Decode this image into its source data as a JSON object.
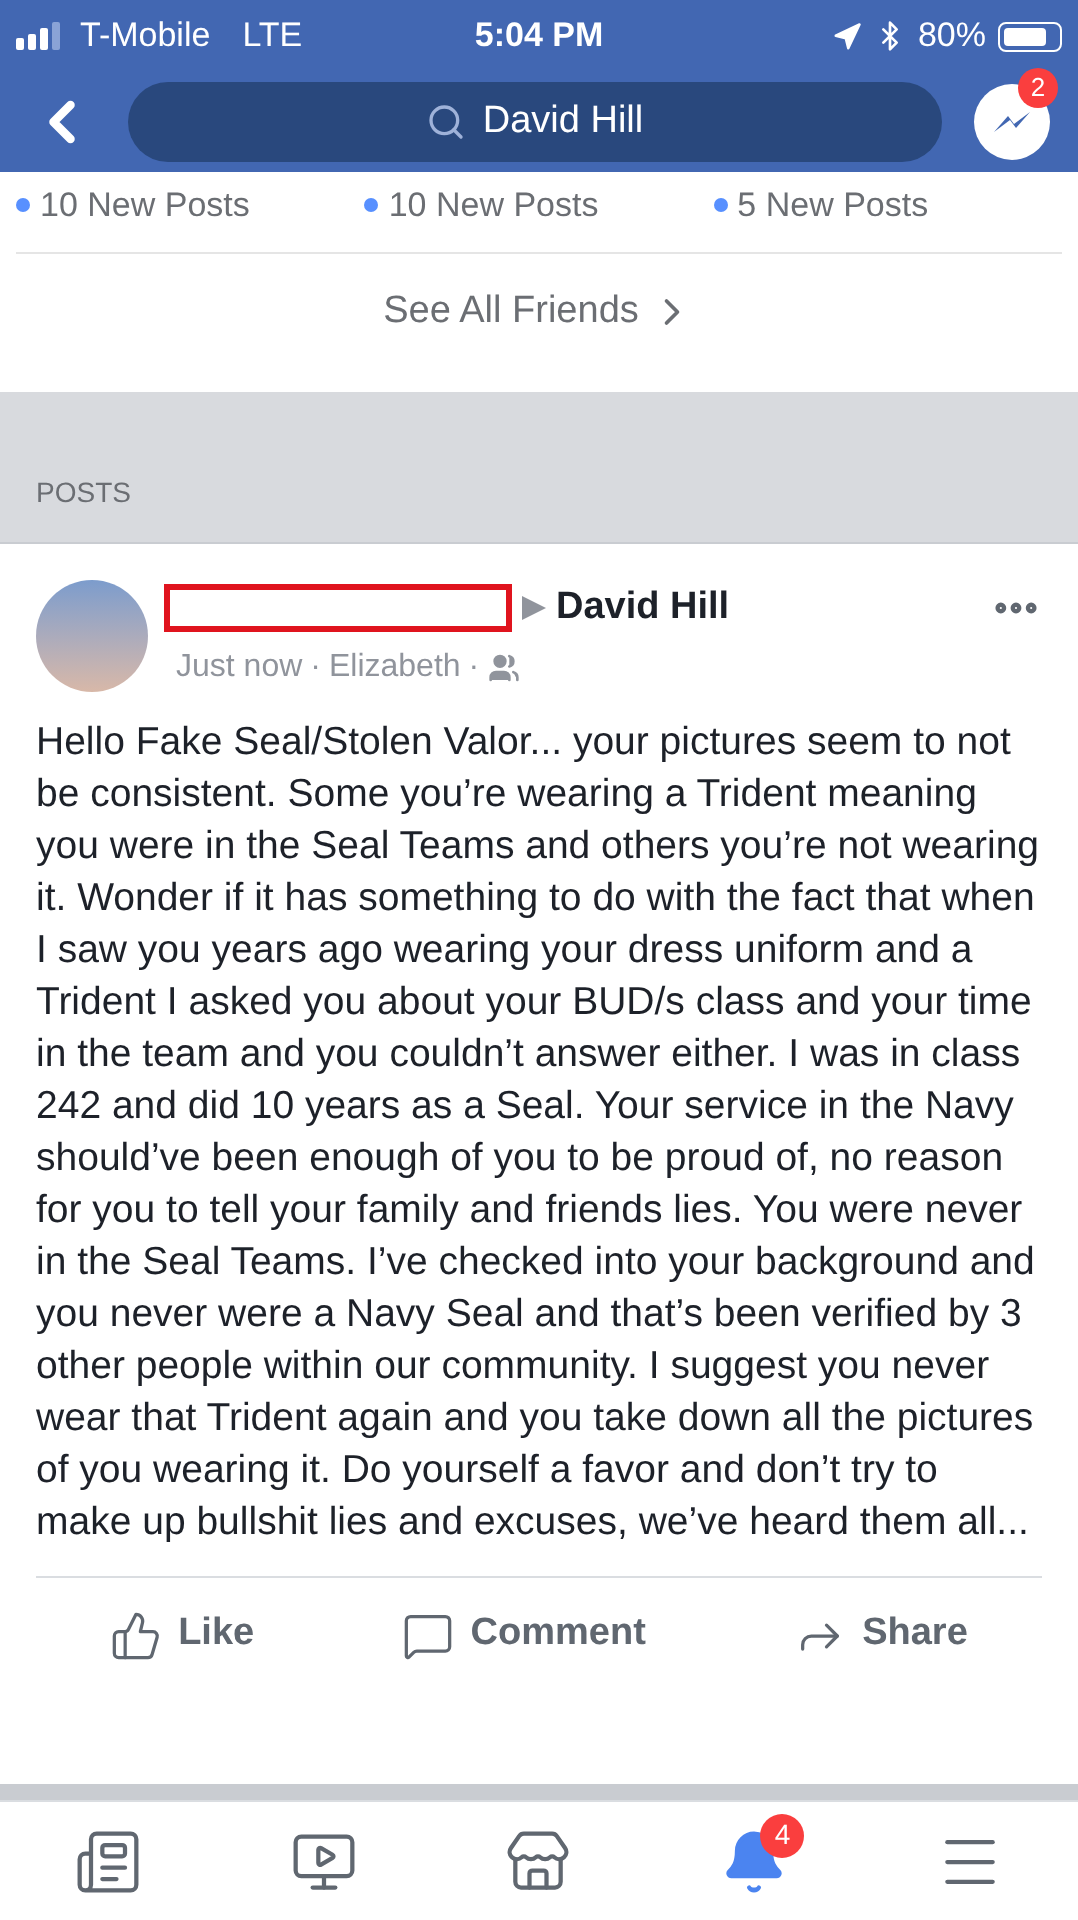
{
  "status_bar": {
    "carrier": "T-Mobile",
    "network": "LTE",
    "time": "5:04 PM",
    "battery": "80%"
  },
  "header": {
    "search_value": "David Hill",
    "messenger_badge": "2"
  },
  "friends": [
    {
      "posts": "10 New Posts"
    },
    {
      "posts": "10 New Posts"
    },
    {
      "posts": "5 New Posts"
    }
  ],
  "see_all": "See All Friends",
  "section_title": "POSTS",
  "post": {
    "target": "David Hill",
    "time": "Just now",
    "location": "Elizabeth",
    "separator": "·",
    "text": "Hello Fake Seal/Stolen Valor... your pictures seem to not be consistent. Some you’re wearing a Trident meaning you were in the Seal Teams and others you’re not wearing it. Wonder if it has something to do with the fact that when I saw you years ago wearing your dress uniform and a Trident I asked you about your BUD/s class and your time in the team and you couldn’t answer either. I was in class 242 and did 10 years as a Seal. Your service in the Navy should’ve been enough of you to be proud of, no reason for you to tell your family and friends lies. You were never in the Seal Teams. I’ve checked into your background and you never were a Navy Seal and that’s been verified by 3 other people within our community. I suggest you never wear that Trident again and you take down all the pictures of you wearing it. Do yourself a favor and don’t try to make up bullshit lies and excuses, we’ve heard them all...",
    "actions": [
      {
        "kind": "like",
        "label": "Like"
      },
      {
        "kind": "comment",
        "label": "Comment"
      },
      {
        "kind": "share",
        "label": "Share"
      }
    ]
  },
  "tab_bar": [
    {
      "kind": "feed",
      "selected": false
    },
    {
      "kind": "video",
      "selected": false
    },
    {
      "kind": "market",
      "selected": false
    },
    {
      "kind": "notifications",
      "selected": true,
      "badge": "4"
    },
    {
      "kind": "menu",
      "selected": false
    }
  ]
}
